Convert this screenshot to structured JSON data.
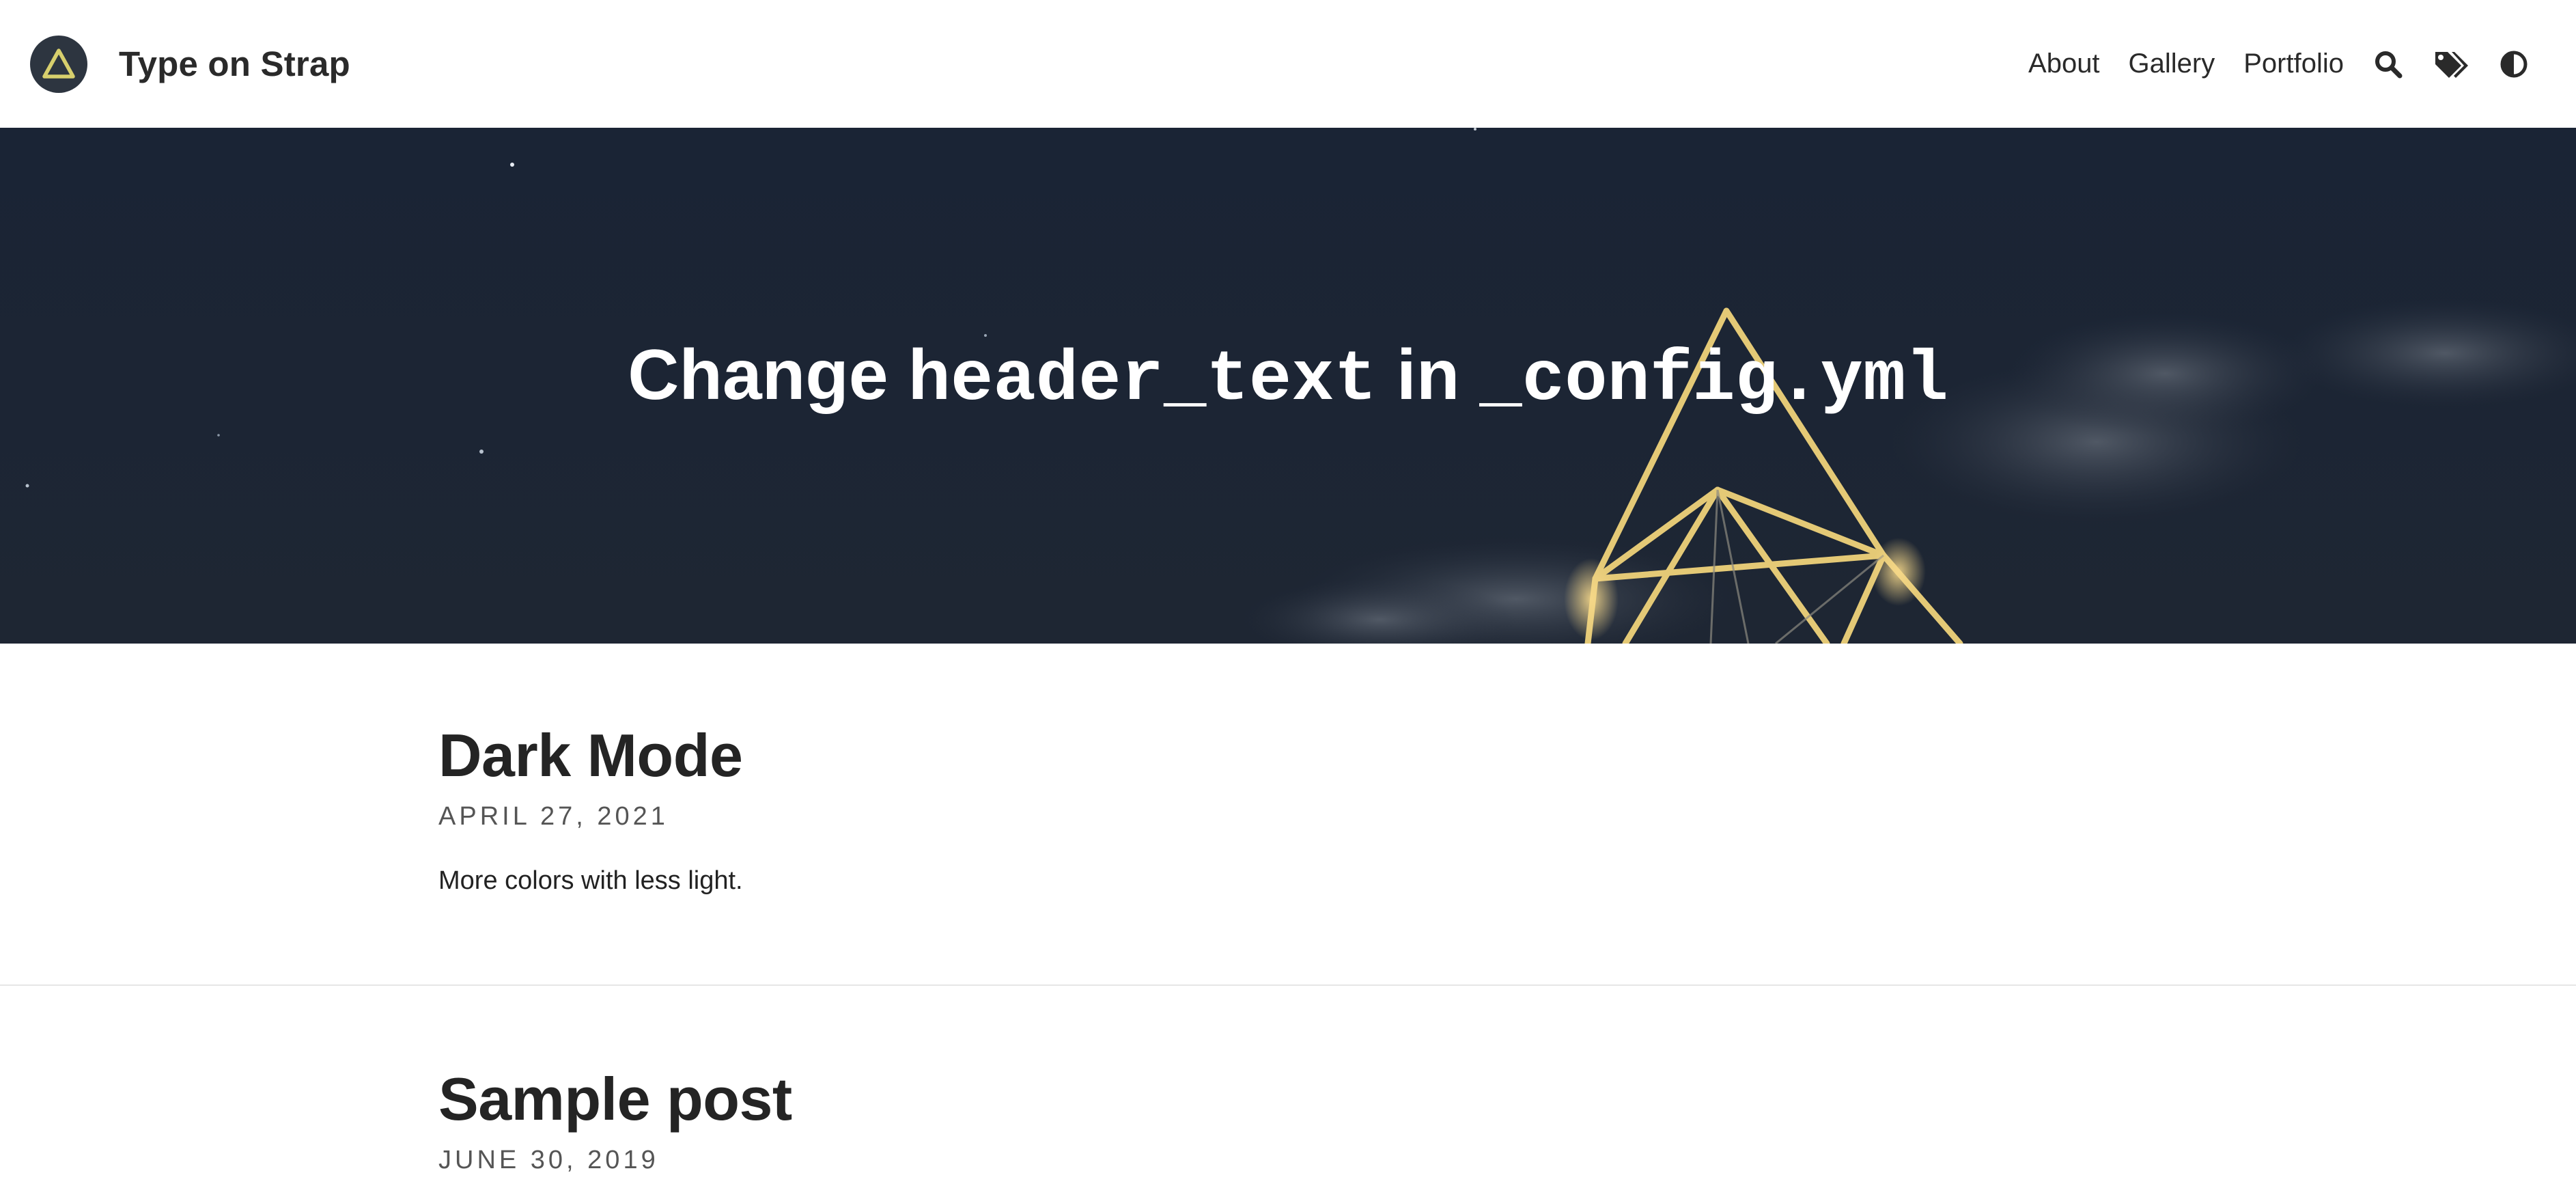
{
  "site": {
    "title": "Type on Strap"
  },
  "nav": {
    "links": [
      {
        "label": "About"
      },
      {
        "label": "Gallery"
      },
      {
        "label": "Portfolio"
      }
    ],
    "icons": [
      "search-icon",
      "tags-icon",
      "theme-toggle-icon"
    ]
  },
  "hero": {
    "title_prefix": "Change",
    "title_code_1": "header_text",
    "title_middle": "in",
    "title_code_2": "_config.yml"
  },
  "posts": [
    {
      "title": "Dark Mode",
      "date": "APRIL 27, 2021",
      "excerpt": "More colors with less light."
    },
    {
      "title": "Sample post",
      "date": "JUNE 30, 2019"
    }
  ],
  "colors": {
    "nav_background": "#ffffff",
    "hero_sky": "#1b2432",
    "logo_circle": "#2d3540",
    "logo_triangle": "#d7cf6d",
    "hero_light": "#f1d77a",
    "text_dark": "#242424",
    "divider": "#e6e6e6"
  }
}
